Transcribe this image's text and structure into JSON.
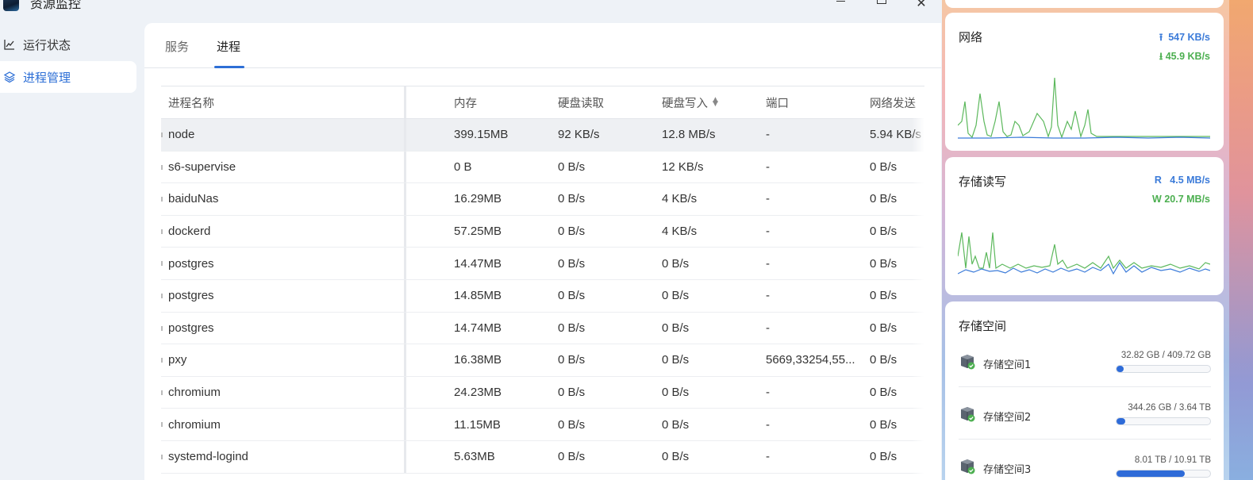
{
  "window": {
    "title": "资源监控",
    "minimize_icon": "minimize-icon",
    "maximize_icon": "maximize-icon",
    "close_glyph": "✕"
  },
  "sidebar": {
    "items": [
      {
        "label": "运行状态",
        "icon": "line-chart-icon",
        "active": false
      },
      {
        "label": "进程管理",
        "icon": "layers-icon",
        "active": true
      }
    ]
  },
  "tabs": [
    {
      "label": "服务",
      "active": false
    },
    {
      "label": "进程",
      "active": true
    }
  ],
  "table": {
    "headers": {
      "name": "进程名称",
      "memory": "内存",
      "disk_read": "硬盘读取",
      "disk_write": "硬盘写入",
      "port": "端口",
      "net_send": "网络发送"
    },
    "sorted_column": "disk_write",
    "rows": [
      {
        "name": "node",
        "memory": "399.15MB",
        "read": "92 KB/s",
        "write": "12.8 MB/s",
        "port": "-",
        "net": "5.94 KB/s"
      },
      {
        "name": "s6-supervise",
        "memory": "0 B",
        "read": "0 B/s",
        "write": "12 KB/s",
        "port": "-",
        "net": "0 B/s"
      },
      {
        "name": "baiduNas",
        "memory": "16.29MB",
        "read": "0 B/s",
        "write": "4 KB/s",
        "port": "-",
        "net": "0 B/s"
      },
      {
        "name": "dockerd",
        "memory": "57.25MB",
        "read": "0 B/s",
        "write": "4 KB/s",
        "port": "-",
        "net": "0 B/s"
      },
      {
        "name": "postgres",
        "memory": "14.47MB",
        "read": "0 B/s",
        "write": "0 B/s",
        "port": "-",
        "net": "0 B/s"
      },
      {
        "name": "postgres",
        "memory": "14.85MB",
        "read": "0 B/s",
        "write": "0 B/s",
        "port": "-",
        "net": "0 B/s"
      },
      {
        "name": "postgres",
        "memory": "14.74MB",
        "read": "0 B/s",
        "write": "0 B/s",
        "port": "-",
        "net": "0 B/s"
      },
      {
        "name": "pxy",
        "memory": "16.38MB",
        "read": "0 B/s",
        "write": "0 B/s",
        "port": "5669,33254,55...",
        "net": "0 B/s"
      },
      {
        "name": "chromium",
        "memory": "24.23MB",
        "read": "0 B/s",
        "write": "0 B/s",
        "port": "-",
        "net": "0 B/s"
      },
      {
        "name": "chromium",
        "memory": "11.15MB",
        "read": "0 B/s",
        "write": "0 B/s",
        "port": "-",
        "net": "0 B/s"
      },
      {
        "name": "systemd-logind",
        "memory": "5.63MB",
        "read": "0 B/s",
        "write": "0 B/s",
        "port": "-",
        "net": "0 B/s"
      }
    ]
  },
  "widgets": {
    "network": {
      "title": "网络",
      "up": "547 KB/s",
      "down": "45.9 KB/s",
      "up_icon": "upload-arrow-icon",
      "down_icon": "download-arrow-icon",
      "colors": {
        "up": "#3b7bd9",
        "down": "#4caf50"
      }
    },
    "storage_io": {
      "title": "存储读写",
      "read_prefix": "R",
      "read": "4.5 MB/s",
      "write_prefix": "W",
      "write": "20.7 MB/s"
    },
    "storage_space": {
      "title": "存储空间",
      "volumes": [
        {
          "name": "存储空间1",
          "used": "32.82 GB",
          "total": "409.72 GB",
          "usage": 0.08
        },
        {
          "name": "存储空间2",
          "used": "344.26 GB",
          "total": "3.64 TB",
          "usage": 0.09
        },
        {
          "name": "存储空间3",
          "used": "8.01 TB",
          "total": "10.91 TB",
          "usage": 0.73
        }
      ]
    }
  }
}
